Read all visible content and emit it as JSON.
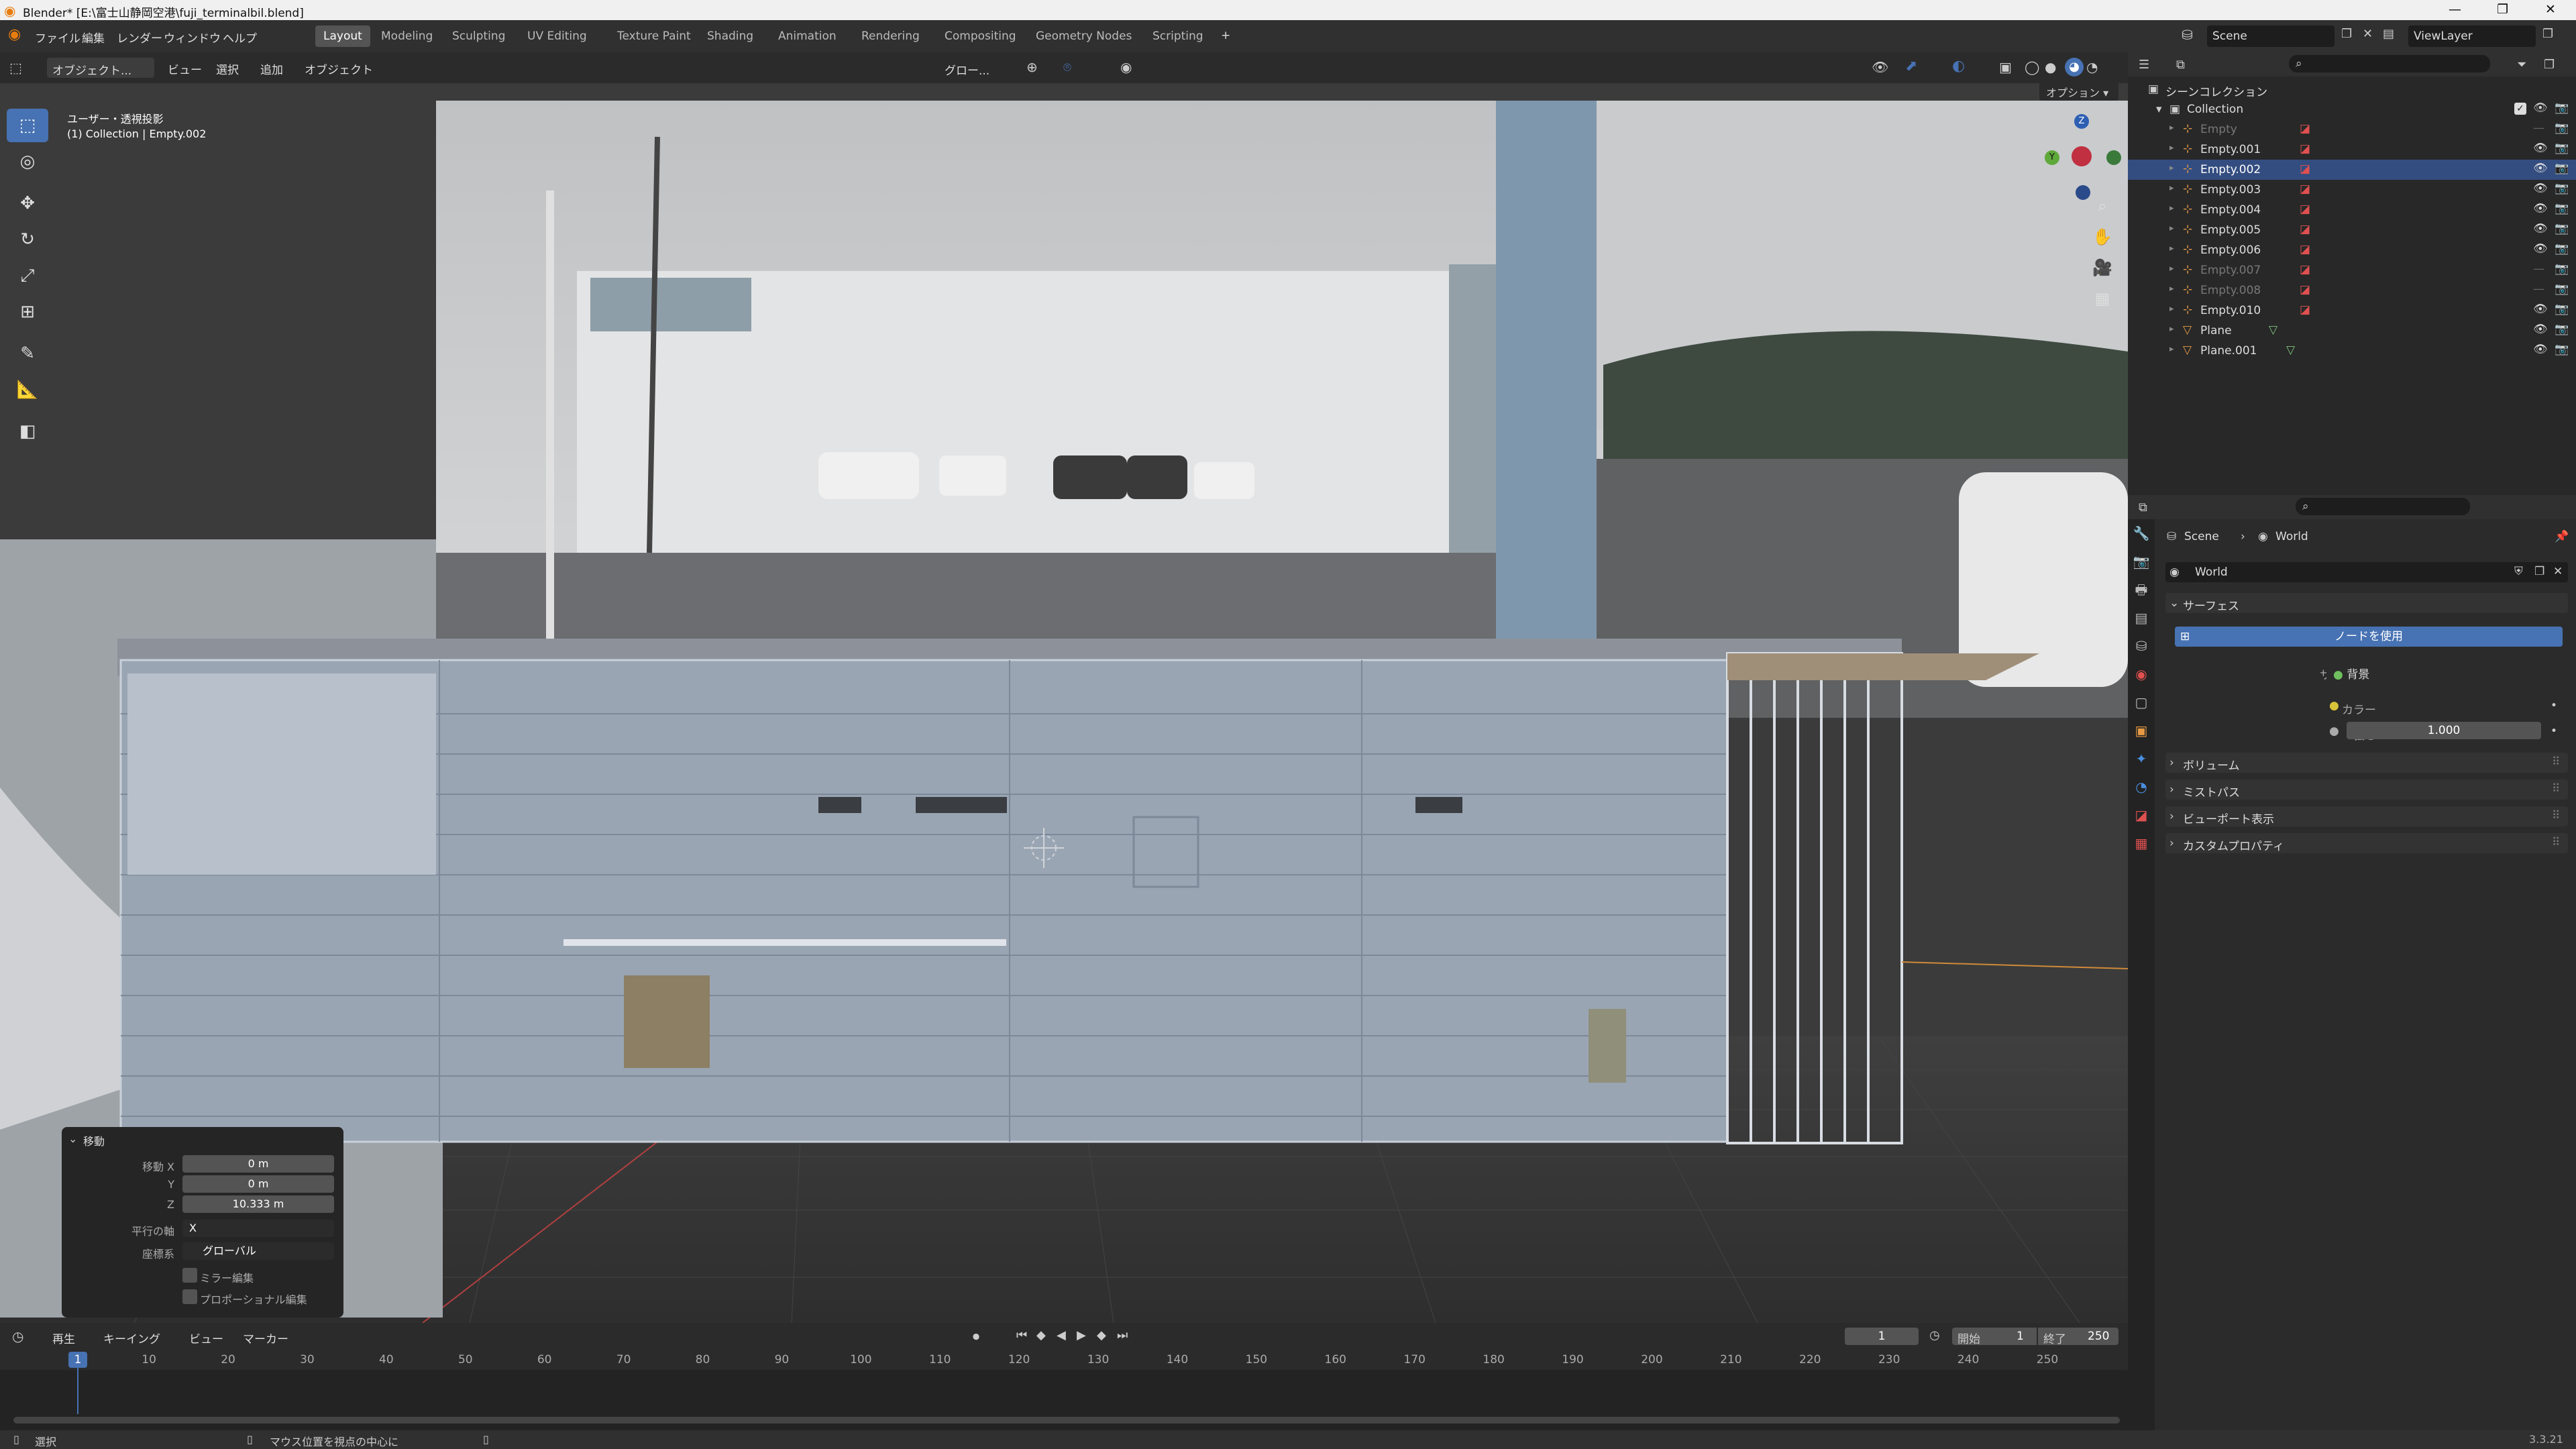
{
  "window": {
    "title": "Blender* [E:\\富士山静岡空港\\fuji_terminalbil.blend]",
    "min": "—",
    "max": "❐",
    "close": "✕"
  },
  "menu": [
    "ファイル",
    "編集",
    "レンダー",
    "ウィンドウ",
    "ヘルプ"
  ],
  "workspaces": [
    "Layout",
    "Modeling",
    "Sculpting",
    "UV Editing",
    "Texture Paint",
    "Shading",
    "Animation",
    "Rendering",
    "Compositing",
    "Geometry Nodes",
    "Scripting"
  ],
  "active_workspace": "Layout",
  "add_workspace": "+",
  "scene": {
    "name": "Scene",
    "view_layer": "ViewLayer"
  },
  "viewport_header": {
    "mode": "オブジェクト...",
    "menus": [
      "ビュー",
      "選択",
      "追加",
      "オブジェクト"
    ],
    "transform": "グロー...",
    "options": "オプション"
  },
  "viewport": {
    "view_name": "ユーザー・透視投影",
    "collection_info": "(1) Collection | Empty.002"
  },
  "gizmo": {
    "z": "Z",
    "y": "Y"
  },
  "tools": [
    {
      "name": "select-box",
      "glyph": "⬚"
    },
    {
      "name": "cursor",
      "glyph": "◎"
    },
    {
      "name": "move",
      "glyph": "✥"
    },
    {
      "name": "rotate",
      "glyph": "↻"
    },
    {
      "name": "scale",
      "glyph": "⤢"
    },
    {
      "name": "transform",
      "glyph": "⊞"
    },
    {
      "name": "annotate",
      "glyph": "✎"
    },
    {
      "name": "measure",
      "glyph": "📐"
    },
    {
      "name": "add-cube",
      "glyph": "◧"
    }
  ],
  "redo_panel": {
    "title": "移動",
    "labels": [
      "移動 X",
      "Y",
      "Z"
    ],
    "values": [
      "0 m",
      "0 m",
      "10.333 m"
    ],
    "axis_label": "平行の軸",
    "axis_value": "X",
    "orient_label": "座標系",
    "orient_value": "グローバル",
    "mirror": "ミラー編集",
    "proportional": "プロポーショナル編集"
  },
  "outliner": {
    "root": "シーンコレクション",
    "collection": "Collection",
    "items": [
      {
        "name": "Empty",
        "dim": true,
        "sel": false,
        "type": "empty"
      },
      {
        "name": "Empty.001",
        "dim": false,
        "sel": false,
        "type": "empty"
      },
      {
        "name": "Empty.002",
        "dim": false,
        "sel": true,
        "type": "empty"
      },
      {
        "name": "Empty.003",
        "dim": false,
        "sel": false,
        "type": "empty"
      },
      {
        "name": "Empty.004",
        "dim": false,
        "sel": false,
        "type": "empty"
      },
      {
        "name": "Empty.005",
        "dim": false,
        "sel": false,
        "type": "empty"
      },
      {
        "name": "Empty.006",
        "dim": false,
        "sel": false,
        "type": "empty"
      },
      {
        "name": "Empty.007",
        "dim": true,
        "sel": false,
        "type": "empty"
      },
      {
        "name": "Empty.008",
        "dim": true,
        "sel": false,
        "type": "empty"
      },
      {
        "name": "Empty.010",
        "dim": false,
        "sel": false,
        "type": "empty"
      },
      {
        "name": "Plane",
        "dim": false,
        "sel": false,
        "type": "mesh"
      },
      {
        "name": "Plane.001",
        "dim": false,
        "sel": false,
        "type": "mesh"
      }
    ]
  },
  "properties": {
    "breadcrumb_scene": "Scene",
    "breadcrumb_world": "World",
    "world_name": "World",
    "surface_panel": "サーフェス",
    "use_nodes": "ノードを使用",
    "surface_label": "サーフェス",
    "surface_value": "背景",
    "color_label": "カラー",
    "strength_label": "強さ",
    "strength_value": "1.000",
    "panels": [
      "ボリューム",
      "ミストパス",
      "ビューポート表示",
      "カスタムプロパティ"
    ]
  },
  "timeline": {
    "menus": [
      "再生",
      "キーイング",
      "ビュー",
      "マーカー"
    ],
    "current_frame": "1",
    "start_label": "開始",
    "start": "1",
    "end_label": "終了",
    "end": "250",
    "ticks": [
      "1",
      "10",
      "20",
      "30",
      "40",
      "50",
      "60",
      "70",
      "80",
      "90",
      "100",
      "110",
      "120",
      "130",
      "140",
      "150",
      "160",
      "170",
      "180",
      "190",
      "200",
      "210",
      "220",
      "230",
      "240",
      "250"
    ]
  },
  "status": {
    "select": "選択",
    "center_view": "マウス位置を視点の中心に",
    "version": "3.3.21"
  },
  "colors": {
    "accent": "#4772b3",
    "selected_row": "#334d80",
    "object_orange": "#e69a45",
    "mesh_green": "#7fc47f"
  }
}
